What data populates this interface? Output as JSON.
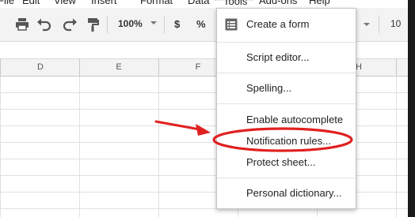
{
  "menubar": {
    "items": [
      {
        "label": "File"
      },
      {
        "label": "Edit"
      },
      {
        "label": "View"
      },
      {
        "label": "Insert"
      },
      {
        "label": "Format"
      },
      {
        "label": "Data"
      },
      {
        "label": "Tools"
      },
      {
        "label": "Add-ons"
      },
      {
        "label": "Help"
      }
    ]
  },
  "toolbar": {
    "zoom": "100%",
    "currency": "$",
    "percent": "%",
    "font_size": "10",
    "icons": [
      "print-icon",
      "undo-icon",
      "redo-icon",
      "paint-format-icon"
    ]
  },
  "columns": [
    "D",
    "E",
    "F",
    "H"
  ],
  "tools_menu": {
    "items": [
      {
        "label": "Create a form",
        "icon": "form-icon"
      },
      {
        "label": "Script editor..."
      },
      {
        "label": "Spelling..."
      },
      {
        "label": "Enable autocomplete"
      },
      {
        "label": "Notification rules...",
        "highlighted": true
      },
      {
        "label": "Protect sheet..."
      },
      {
        "label": "Personal dictionary..."
      }
    ]
  },
  "annotation": {
    "arrow_color": "#e02020",
    "ellipse_color": "#e02020"
  }
}
